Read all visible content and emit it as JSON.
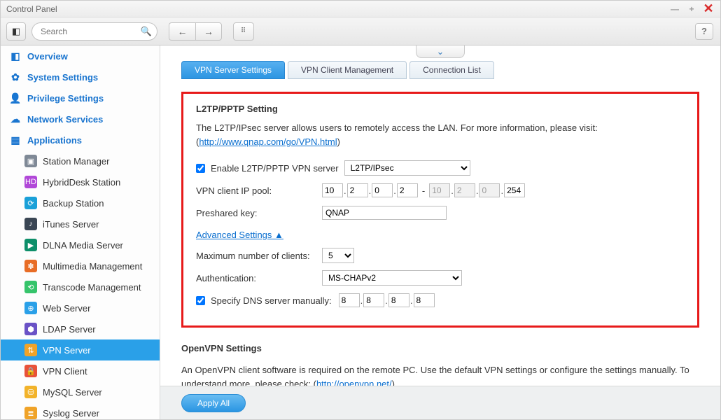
{
  "window": {
    "title": "Control Panel"
  },
  "toolbar": {
    "search_placeholder": "Search"
  },
  "sidebar": {
    "categories": [
      {
        "label": "Overview",
        "icon": "◧",
        "color": "#1a75cf"
      },
      {
        "label": "System Settings",
        "icon": "✿",
        "color": "#1a75cf"
      },
      {
        "label": "Privilege Settings",
        "icon": "👤",
        "color": "#1a75cf"
      },
      {
        "label": "Network Services",
        "icon": "☁",
        "color": "#1a75cf"
      },
      {
        "label": "Applications",
        "icon": "▦",
        "color": "#1a75cf"
      }
    ],
    "items": [
      {
        "label": "Station Manager",
        "icon": "▣",
        "bg": "#7f8996"
      },
      {
        "label": "HybridDesk Station",
        "icon": "HD",
        "bg": "#b148d8"
      },
      {
        "label": "Backup Station",
        "icon": "⟳",
        "bg": "#1aa0d8"
      },
      {
        "label": "iTunes Server",
        "icon": "♪",
        "bg": "#3a4654"
      },
      {
        "label": "DLNA Media Server",
        "icon": "▶",
        "bg": "#0e8f6a"
      },
      {
        "label": "Multimedia Management",
        "icon": "✽",
        "bg": "#e86d26"
      },
      {
        "label": "Transcode Management",
        "icon": "⟲",
        "bg": "#36c46b"
      },
      {
        "label": "Web Server",
        "icon": "⊕",
        "bg": "#2aa0e8"
      },
      {
        "label": "LDAP Server",
        "icon": "⬢",
        "bg": "#6a52c6"
      },
      {
        "label": "VPN Server",
        "icon": "⇅",
        "bg": "#f0a328",
        "active": true
      },
      {
        "label": "VPN Client",
        "icon": "🔒",
        "bg": "#e8523a"
      },
      {
        "label": "MySQL Server",
        "icon": "⛁",
        "bg": "#f2b32a"
      },
      {
        "label": "Syslog Server",
        "icon": "≣",
        "bg": "#f0a328"
      }
    ]
  },
  "tabs": [
    {
      "label": "VPN Server Settings",
      "active": true
    },
    {
      "label": "VPN Client Management",
      "active": false
    },
    {
      "label": "Connection List",
      "active": false
    }
  ],
  "l2tp": {
    "section_title": "L2TP/PPTP Setting",
    "desc_pre": "The L2TP/IPsec server allows users to remotely access the LAN. For more information, please visit: (",
    "desc_link": "http://www.qnap.com/go/VPN.html",
    "desc_post": ")",
    "enable_label": "Enable L2TP/PPTP VPN server",
    "enable_checked": true,
    "type_selected": "L2TP/IPsec",
    "ip_pool_label": "VPN client IP pool:",
    "ip_start": [
      "10",
      "2",
      "0",
      "2"
    ],
    "ip_end": [
      "10",
      "2",
      "0",
      "254"
    ],
    "psk_label": "Preshared key:",
    "psk_value": "QNAP",
    "advanced_label": "Advanced Settings ▲",
    "max_clients_label": "Maximum number of clients:",
    "max_clients_value": "5",
    "auth_label": "Authentication:",
    "auth_value": "MS-CHAPv2",
    "dns_label": "Specify DNS server manually:",
    "dns_checked": true,
    "dns": [
      "8",
      "8",
      "8",
      "8"
    ]
  },
  "openvpn": {
    "title": "OpenVPN Settings",
    "desc_pre": "An OpenVPN client software is required on the remote PC. Use the default VPN settings or configure the settings manually. To understand more, please check: (",
    "desc_link": "http://openvpn.net/",
    "desc_post": ")"
  },
  "footer": {
    "apply_label": "Apply All"
  }
}
